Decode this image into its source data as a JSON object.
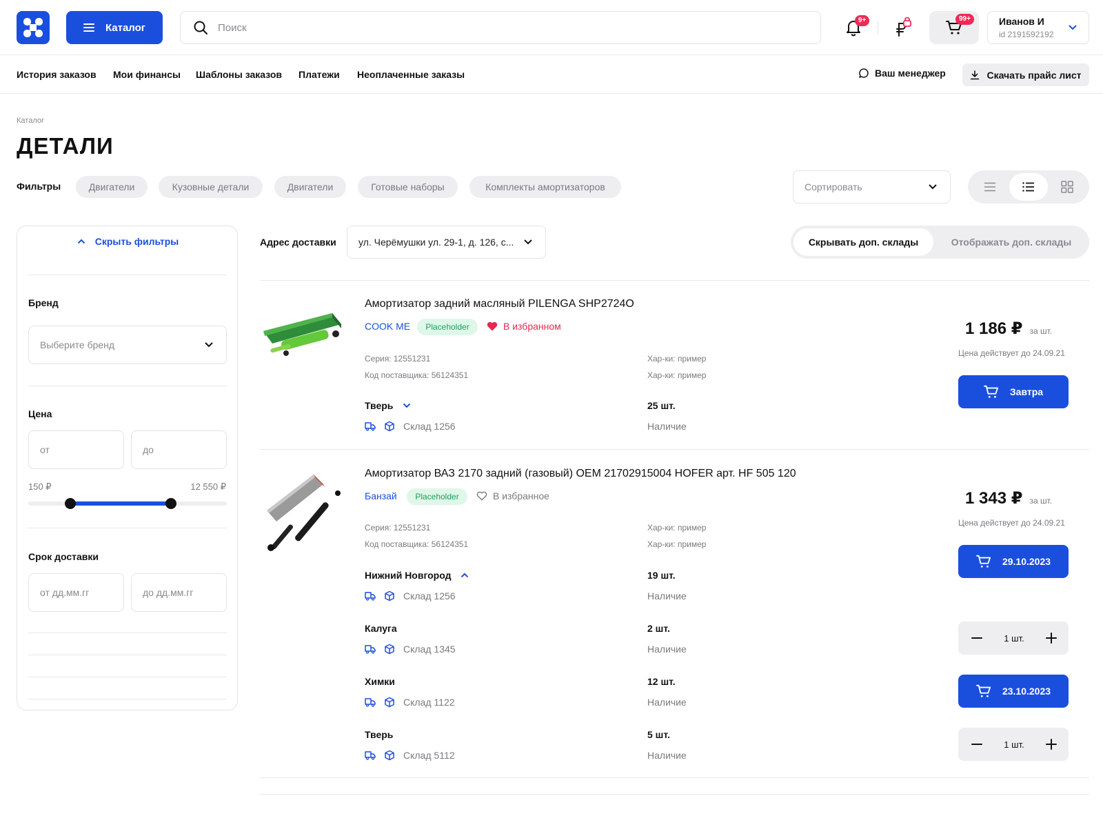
{
  "header": {
    "catalog_label": "Каталог",
    "search_placeholder": "Поиск",
    "notifications_badge": "9+",
    "cart_badge": "99+",
    "user_name": "Иванов И",
    "user_id": "id 2191592192"
  },
  "nav": {
    "items": [
      "История заказов",
      "Мои финансы",
      "Шаблоны заказов",
      "Платежи",
      "Неоплаченные заказы"
    ],
    "manager_label": "Ваш менеджер",
    "download_label": "Скачать прайс лист"
  },
  "page": {
    "breadcrumb": "Каталог",
    "title": "ДЕТАЛИ"
  },
  "filters_bar": {
    "label": "Фильтры",
    "chips": [
      "Двигатели",
      "Кузовные детали",
      "Двигатели",
      "Готовые наборы",
      "Комплекты амортизаторов"
    ],
    "sort_placeholder": "Сортировать",
    "view_active": "list"
  },
  "sidebar": {
    "hide_filters": "Скрыть фильтры",
    "brand_label": "Бренд",
    "brand_placeholder": "Выберите бренд",
    "price_label": "Цена",
    "price_from_placeholder": "от",
    "price_to_placeholder": "до",
    "price_min": "150 ₽",
    "price_max": "12 550 ₽",
    "delivery_label": "Срок доставки",
    "delivery_from_placeholder": "от дд.мм.гг",
    "delivery_to_placeholder": "до дд.мм.гг"
  },
  "delivery": {
    "label": "Адрес доставки",
    "address": "ул. Черёмушки ул. 29-1, д. 126, с...",
    "hide_warehouses": "Скрывать  доп. склады",
    "show_warehouses": "Отображать доп. склады"
  },
  "products": [
    {
      "name": "Амортизатор задний масляный PILENGA SHP2724O",
      "brand": "COOK ME",
      "tag": "Placeholder",
      "favorite": "В избранном",
      "series": "Серия: 12551231",
      "supplier_code": "Код поставщика: 56124351",
      "char1": "Хар-ки: пример",
      "char2": "Хар-ки: пример",
      "price": "1 186 ₽",
      "per_unit": "за шт.",
      "valid_until": "Цена действует до 24.09.21",
      "warehouses": [
        {
          "city": "Тверь",
          "warehouse": "Склад 1256",
          "qty": "25 шт.",
          "availability": "Наличие",
          "button": "Завтра"
        }
      ]
    },
    {
      "name": "Амортизатор ВАЗ 2170 задний (газовый) OEM 21702915004 HOFER арт. HF 505 120",
      "brand": "Банзай",
      "tag": "Placeholder",
      "favorite": "В избранное",
      "series": "Серия: 12551231",
      "supplier_code": "Код поставщика: 56124351",
      "char1": "Хар-ки: пример",
      "char2": "Хар-ки: пример",
      "price": "1 343 ₽",
      "per_unit": "за шт.",
      "valid_until": "Цена действует до 24.09.21",
      "warehouses": [
        {
          "city": "Нижний Новгород",
          "warehouse": "Склад 1256",
          "qty": "19 шт.",
          "availability": "Наличие",
          "button": "29.10.2023"
        },
        {
          "city": "Калуга",
          "warehouse": "Склад 1345",
          "qty": "2 шт.",
          "availability": "Наличие",
          "stepper": "1 шт."
        },
        {
          "city": "Химки",
          "warehouse": "Склад 1122",
          "qty": "12 шт.",
          "availability": "Наличие",
          "button": "23.10.2023"
        },
        {
          "city": "Тверь",
          "warehouse": "Склад 5112",
          "qty": "5 шт.",
          "availability": "Наличие",
          "stepper": "1 шт."
        }
      ]
    }
  ],
  "colors": {
    "accent": "#1a4fde",
    "badge": "#ee2a55",
    "favorite": "#e8284f",
    "tag_bg": "#dff7e9",
    "tag_text": "#1aa05a"
  }
}
